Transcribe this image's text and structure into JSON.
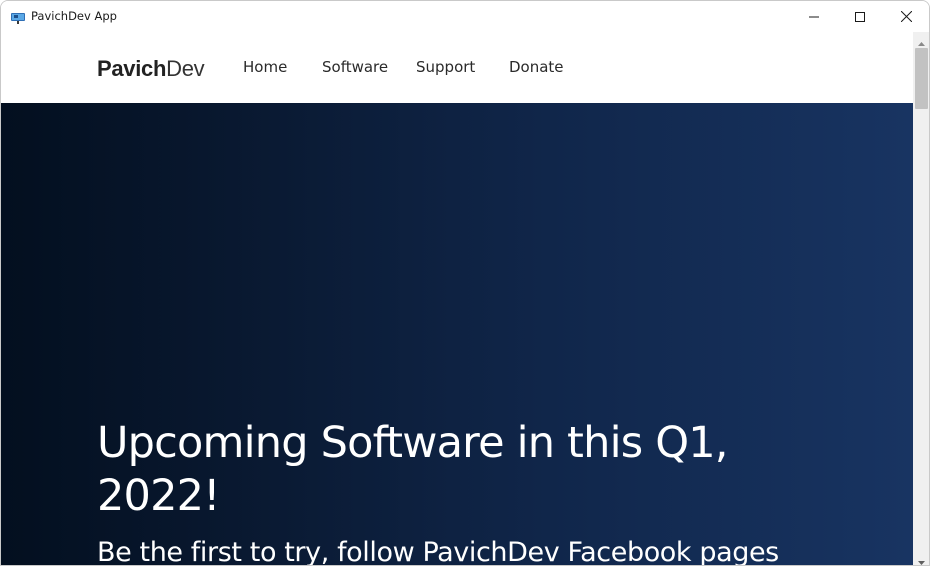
{
  "window": {
    "title": "PavichDev App",
    "icon": "app-monitor-icon",
    "controls": {
      "minimize": "minimize-icon",
      "maximize": "maximize-icon",
      "close": "close-icon"
    }
  },
  "navbar": {
    "logo_bold": "Pavich",
    "logo_light": "Dev",
    "items": [
      {
        "label": "Home"
      },
      {
        "label": "Software"
      },
      {
        "label": "Support"
      },
      {
        "label": "Donate"
      }
    ]
  },
  "hero": {
    "title": "Upcoming Software in this Q1, 2022!",
    "subtitle": "Be the first to try, follow PavichDev Facebook pages"
  },
  "scrollbar": {
    "up_icon": "scroll-up-arrow-icon",
    "down_icon": "scroll-down-arrow-icon"
  },
  "colors": {
    "hero_gradient_start": "#030f1f",
    "hero_gradient_end": "#183462",
    "nav_text": "#2a2a2a",
    "hero_text": "#ffffff"
  }
}
